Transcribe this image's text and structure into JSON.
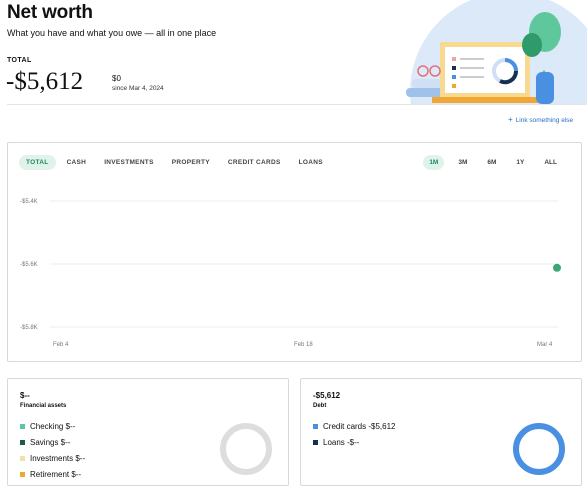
{
  "header": {
    "title": "Net worth",
    "subtitle": "What you have and what you owe — all in one place",
    "total_label": "TOTAL",
    "total_value": "-$5,612",
    "change_value": "$0",
    "change_since": "since Mar 4, 2024"
  },
  "link_something": "Link something else",
  "chart": {
    "tabs": [
      {
        "label": "TOTAL",
        "active": true
      },
      {
        "label": "CASH",
        "active": false
      },
      {
        "label": "INVESTMENTS",
        "active": false
      },
      {
        "label": "PROPERTY",
        "active": false
      },
      {
        "label": "CREDIT CARDS",
        "active": false
      },
      {
        "label": "LOANS",
        "active": false
      }
    ],
    "ranges": [
      {
        "label": "1M",
        "active": true
      },
      {
        "label": "3M",
        "active": false
      },
      {
        "label": "6M",
        "active": false
      },
      {
        "label": "1Y",
        "active": false
      },
      {
        "label": "ALL",
        "active": false
      }
    ]
  },
  "chart_data": {
    "type": "line",
    "series": [
      {
        "x": [
          "Mar 4"
        ],
        "values": [
          -5612
        ]
      }
    ],
    "x_ticks": [
      "Feb 4",
      "Feb 18",
      "Mar 4"
    ],
    "y_ticks": [
      -5400,
      -5600,
      -5800
    ],
    "y_tick_labels": [
      "-$5.4K",
      "-$5.6K",
      "-$5.8K"
    ],
    "ylim": [
      -5800,
      -5400
    ],
    "grid": true,
    "point_color": "#3aa67a"
  },
  "assets": {
    "amount": "$--",
    "name": "Financial assets",
    "items": [
      {
        "label": "Checking $--",
        "color": "#5fc79c"
      },
      {
        "label": "Savings $--",
        "color": "#1f5b3f"
      },
      {
        "label": "Investments $--",
        "color": "#f6dfae"
      },
      {
        "label": "Retirement $--",
        "color": "#f0a733"
      }
    ],
    "donut_color": "#dddddd"
  },
  "debt": {
    "amount": "-$5,612",
    "name": "Debt",
    "items": [
      {
        "label": "Credit cards -$5,612",
        "color": "#4a90e2"
      },
      {
        "label": "Loans -$--",
        "color": "#16304f"
      }
    ],
    "donut_color": "#4a90e2"
  }
}
